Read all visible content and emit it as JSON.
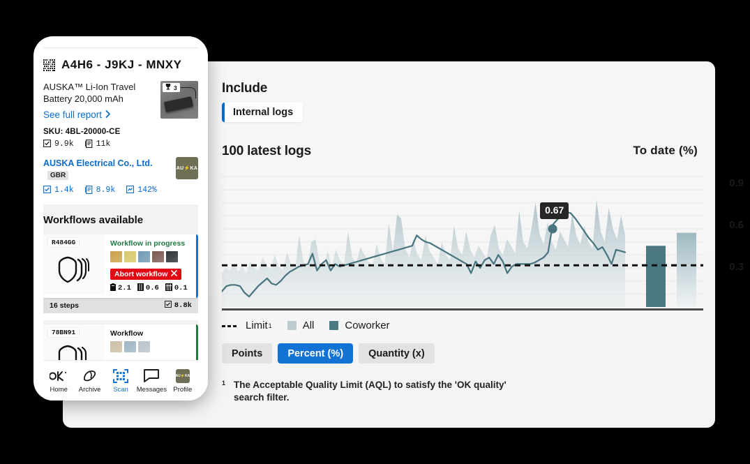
{
  "phone": {
    "code": "A4H6 - J9KJ - MNXY",
    "qr_icon": "qr-code-icon",
    "product": {
      "name": "AUSKA™ Li-Ion Travel Battery 20,000 mAh",
      "see_full_report": "See full report",
      "chevron": "›",
      "trophy_icon": "trophy-icon",
      "trophy_count": "3"
    },
    "sku": "SKU: 4BL-20000-CE",
    "sku_stats": [
      {
        "icon": "checkbox-icon",
        "value": "9.9k"
      },
      {
        "icon": "document-icon",
        "value": "11k"
      }
    ],
    "supplier": {
      "name": "AUSKA Electrical Co., Ltd.",
      "country": "GBR",
      "logo_text": "AU⚡KA",
      "stats": [
        {
          "icon": "checkbox-icon",
          "value": "1.4k"
        },
        {
          "icon": "document-icon",
          "value": "8.9k"
        },
        {
          "icon": "chart-icon",
          "value": "142%"
        }
      ]
    },
    "workflows": {
      "title": "Workflows available",
      "cards": [
        {
          "id": "R484GG",
          "status": "Workflow in progress",
          "status_color": "#1e7a42",
          "accent": "#1273d4",
          "abort_label": "Abort workflow",
          "abort_icon": "close-x-icon",
          "thumbs": [
            "#c9a24a",
            "#d7c96a",
            "#6f9ab5",
            "#7a5a52",
            "#2f3336"
          ],
          "metrics": [
            {
              "icon": "battery-icon",
              "value": "2.1"
            },
            {
              "icon": "module-icon",
              "value": "0.6"
            },
            {
              "icon": "grid-icon",
              "value": "0.1"
            }
          ],
          "steps": "16 steps",
          "foot_icon": "checkbox-icon",
          "foot_value": "8.8k"
        },
        {
          "id": "78BN91",
          "status": "Workflow",
          "status_color": "#111111",
          "accent": "#1e7a42",
          "thumbs": [
            "#cdbfa6",
            "#9fb6c4",
            "#b8c3cb"
          ]
        }
      ]
    },
    "tabs": [
      {
        "label": "Home",
        "icon": "ok-logo-icon",
        "active": false
      },
      {
        "label": "Archive",
        "icon": "archive-icon",
        "active": false
      },
      {
        "label": "Scan",
        "icon": "scan-qr-icon",
        "active": true
      },
      {
        "label": "Messages",
        "icon": "message-bubble-icon",
        "active": false
      },
      {
        "label": "Profile",
        "icon": "profile-avatar-icon",
        "active": false
      }
    ]
  },
  "panel": {
    "include_label": "Include",
    "include_chip": "Internal logs",
    "chart_title": "100 latest logs",
    "todate_title": "To date  (%)",
    "legend": [
      {
        "name": "Limit",
        "sup": "1",
        "style": "dashed",
        "color": "#111111"
      },
      {
        "name": "All",
        "style": "swatch",
        "color": "#bcccd1"
      },
      {
        "name": "Coworker",
        "style": "swatch",
        "color": "#4a7780"
      }
    ],
    "toggles": [
      {
        "label": "Points",
        "active": false
      },
      {
        "label": "Percent (%)",
        "active": true
      },
      {
        "label": "Quantity (x)",
        "active": false
      }
    ],
    "footnote_mark": "1",
    "footnote_text": "The Acceptable Quality Limit (AQL) to satisfy the 'OK quality' search filter.",
    "tooltip_value": "0.67"
  },
  "chart_data": {
    "type": "area",
    "title": "100 latest logs",
    "xlabel": "",
    "ylabel": "To date (%)",
    "ylim": [
      0,
      1.05
    ],
    "yticks": [
      0.3,
      0.6,
      0.9
    ],
    "ytick_labels": [
      "0.3",
      "0.6",
      "0.9"
    ],
    "grid": true,
    "legend_position": "below",
    "limit_value": 0.32,
    "annotation": {
      "label": "0.67",
      "x_index": 73,
      "y": 0.67
    },
    "series": [
      {
        "name": "All",
        "type": "area",
        "color": "#bcccd1",
        "values": [
          0.26,
          0.3,
          0.28,
          0.33,
          0.27,
          0.31,
          0.26,
          0.35,
          0.3,
          0.28,
          0.38,
          0.32,
          0.29,
          0.4,
          0.31,
          0.28,
          0.42,
          0.33,
          0.3,
          0.55,
          0.35,
          0.31,
          0.5,
          0.52,
          0.34,
          0.3,
          0.43,
          0.31,
          0.44,
          0.36,
          0.33,
          0.58,
          0.38,
          0.34,
          0.46,
          0.4,
          0.35,
          0.32,
          0.48,
          0.37,
          0.33,
          0.64,
          0.42,
          0.71,
          0.68,
          0.45,
          0.38,
          0.52,
          0.4,
          0.36,
          0.55,
          0.43,
          0.38,
          0.33,
          0.5,
          0.4,
          0.36,
          0.62,
          0.45,
          0.4,
          0.58,
          0.44,
          0.38,
          0.47,
          0.42,
          0.37,
          0.55,
          0.63,
          0.45,
          0.4,
          0.52,
          0.47,
          0.41,
          0.74,
          0.5,
          0.45,
          0.6,
          0.8,
          0.56,
          0.48,
          0.65,
          0.5,
          0.44,
          0.58,
          0.52,
          0.46,
          0.72,
          0.55,
          0.48,
          0.62,
          0.5,
          0.45,
          0.82,
          0.58,
          0.5,
          0.76,
          0.6,
          0.52,
          0.7,
          0.55
        ]
      },
      {
        "name": "Coworker",
        "type": "line",
        "color": "#47747e",
        "values": [
          0.12,
          0.16,
          0.17,
          0.17,
          0.16,
          0.11,
          0.08,
          0.12,
          0.16,
          0.19,
          0.22,
          0.18,
          0.17,
          0.2,
          0.24,
          0.27,
          0.29,
          0.31,
          0.32,
          0.33,
          0.41,
          0.28,
          0.33,
          0.36,
          0.28,
          0.33,
          0.31,
          0.32,
          0.33,
          0.34,
          0.35,
          0.36,
          0.37,
          0.38,
          0.39,
          0.4,
          0.41,
          0.42,
          0.43,
          0.44,
          0.45,
          0.46,
          0.47,
          0.55,
          0.52,
          0.5,
          0.49,
          0.47,
          0.45,
          0.43,
          0.41,
          0.39,
          0.37,
          0.35,
          0.33,
          0.26,
          0.35,
          0.3,
          0.36,
          0.38,
          0.33,
          0.4,
          0.35,
          0.26,
          0.31,
          0.33,
          0.33,
          0.33,
          0.33,
          0.34,
          0.36,
          0.38,
          0.42,
          0.63,
          0.67,
          0.7,
          0.73,
          0.72,
          0.68,
          0.63,
          0.58,
          0.53,
          0.49,
          0.44,
          0.46,
          0.4,
          0.33,
          0.44,
          0.43,
          0.42
        ]
      }
    ],
    "to_date": {
      "label": "To date  (%)",
      "bars": [
        {
          "name": "Coworker",
          "value": 0.47,
          "color": "#4a7780"
        },
        {
          "name": "All",
          "value": 0.57,
          "color": "#9fbac2"
        }
      ]
    }
  }
}
